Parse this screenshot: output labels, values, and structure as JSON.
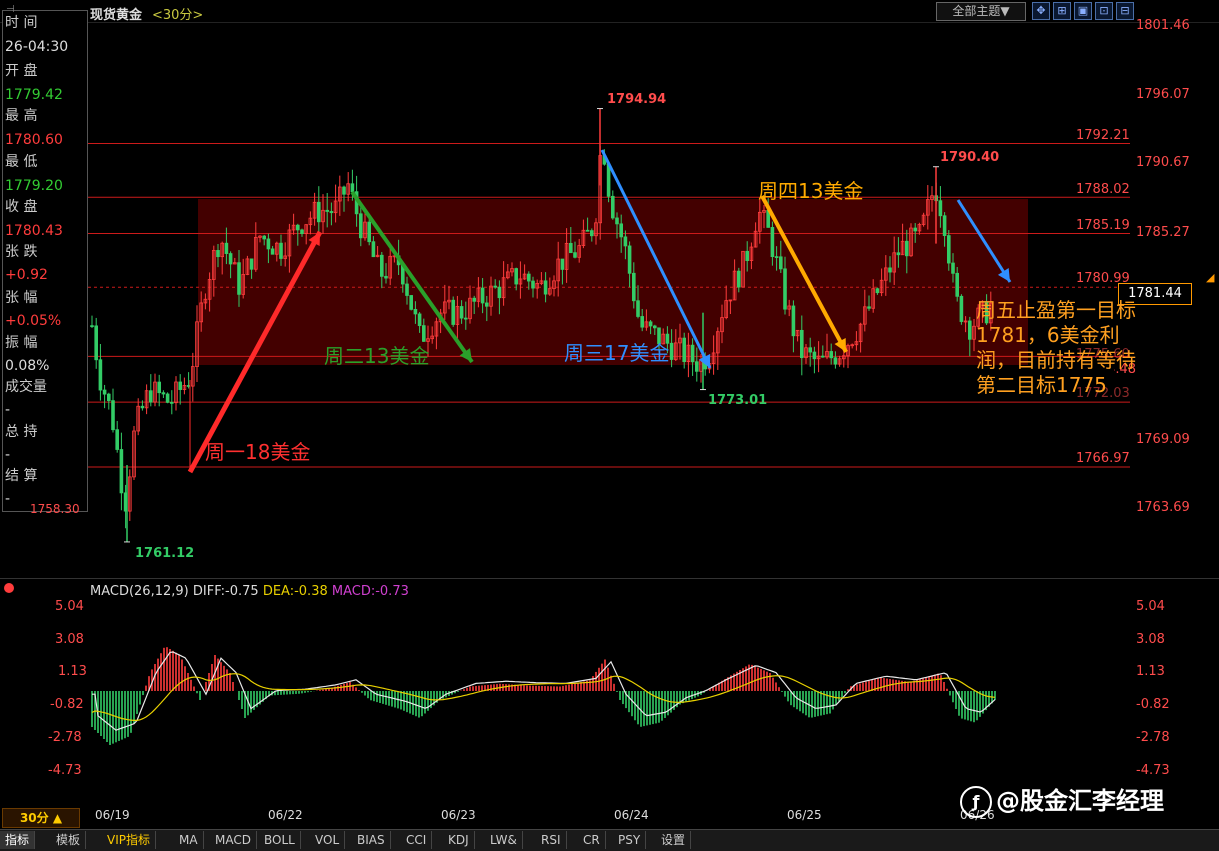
{
  "header": {
    "title": "现货黄金",
    "period": "<30分>",
    "theme_select": "全部主题▼",
    "tools": [
      "✥",
      "⊞",
      "▣",
      "⊡",
      "⊟"
    ]
  },
  "info_panel": {
    "rows": [
      {
        "label": "时 间",
        "value": "26-04:30"
      },
      {
        "label": "开 盘",
        "value": "1779.42"
      },
      {
        "label": "最 高",
        "value": "1780.60"
      },
      {
        "label": "最 低",
        "value": "1779.20"
      },
      {
        "label": "收 盘",
        "value": "1780.43"
      },
      {
        "label": "张 跌",
        "value": "+0.92"
      },
      {
        "label": "张 幅",
        "value": "+0.05%"
      },
      {
        "label": "振 幅",
        "value": "0.08%"
      },
      {
        "label": "成交量",
        "value": "-"
      },
      {
        "label": "总 持",
        "value": "-"
      },
      {
        "label": "结 算",
        "value": "-"
      }
    ],
    "hidden_tick": "1758.30"
  },
  "price_axis": [
    "1801.46",
    "1796.07",
    "1790.67",
    "1785.27",
    "1769.09",
    "1763.69"
  ],
  "price_axis_partial": [
    "1774.48"
  ],
  "levels": [
    "1792.21",
    "1788.02",
    "1785.19",
    "1780.99",
    "1775.60",
    "1772.03",
    "1766.97"
  ],
  "extremes": {
    "high1": "1794.94",
    "high2": "1790.40",
    "low1": "1773.01",
    "low2": "1761.12"
  },
  "current_price": "1781.44",
  "annotations": {
    "mon": "周一18美金",
    "tue": "周二13美金",
    "wed": "周三17美金",
    "thu": "周四13美金",
    "fri_lines": [
      "周五止盈第一目标",
      "1781，6美金利",
      "润，目前持有等待",
      "第二目标1775"
    ]
  },
  "macd": {
    "name": "MACD(26,12,9)",
    "diff": "DIFF:-0.75",
    "dea": "DEA:-0.38",
    "macd": "MACD:-0.73",
    "ticks": [
      "5.04",
      "3.08",
      "1.13",
      "-0.82",
      "-2.78",
      "-4.73"
    ]
  },
  "dates": [
    "06/19",
    "06/22",
    "06/23",
    "06/24",
    "06/25",
    "06/26"
  ],
  "period_button": "30分 ▲",
  "tabs": [
    "指标",
    "模板",
    "VIP指标",
    "MA",
    "MACD",
    "BOLL",
    "VOL",
    "BIAS",
    "CCI",
    "KDJ",
    "LW&",
    "RSI",
    "CR",
    "PSY",
    "设置"
  ],
  "watermark": "@股金汇李经理",
  "colors": {
    "up": "#ff3c3c",
    "down": "#33cc66",
    "zone": "#5a0000",
    "level": "#cc1a1a",
    "mon": "#ff2a2a",
    "tue": "#2aa02a",
    "wed": "#2f8fff",
    "thu": "#ffaa00"
  }
}
